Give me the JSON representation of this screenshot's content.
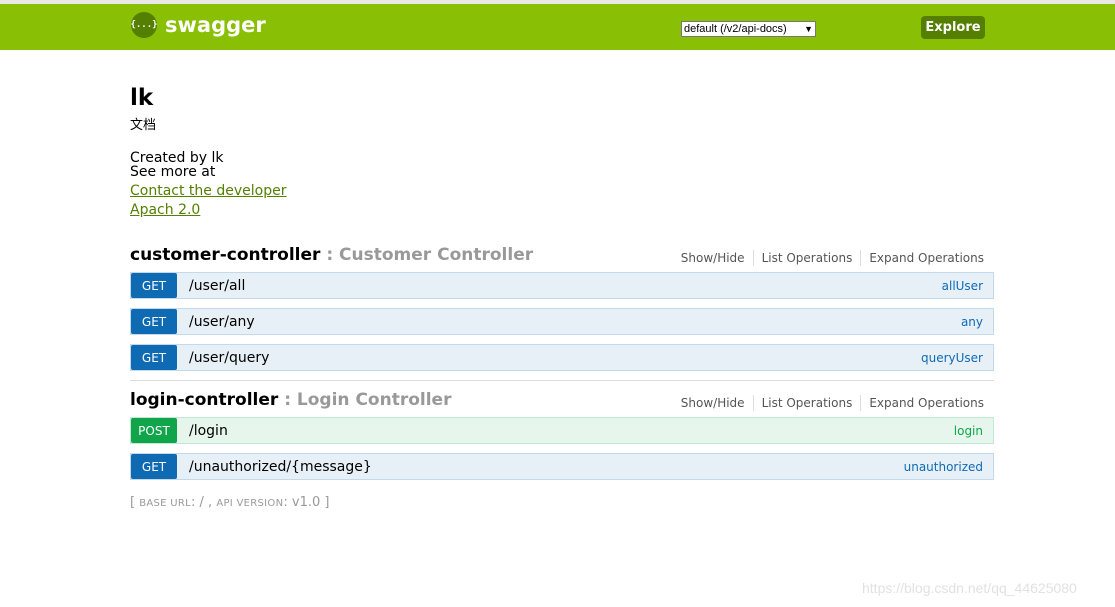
{
  "header": {
    "logo_icon_text": "{...}",
    "logo_text": "swagger",
    "api_select_value": "default (/v2/api-docs)",
    "explore_label": "Explore",
    "brand_color": "#89bf04"
  },
  "info": {
    "title": "lk",
    "description": "文档",
    "created_by": "Created by lk",
    "see_more": "See more at",
    "contact_link": "Contact the developer",
    "license_link": "Apach 2.0"
  },
  "resources": [
    {
      "name": "customer-controller",
      "separator": " : ",
      "description": "Customer Controller",
      "options": [
        "Show/Hide",
        "List Operations",
        "Expand Operations"
      ],
      "operations": [
        {
          "method": "GET",
          "path": "/user/all",
          "nickname": "allUser"
        },
        {
          "method": "GET",
          "path": "/user/any",
          "nickname": "any"
        },
        {
          "method": "GET",
          "path": "/user/query",
          "nickname": "queryUser"
        }
      ]
    },
    {
      "name": "login-controller",
      "separator": " : ",
      "description": "Login Controller",
      "options": [
        "Show/Hide",
        "List Operations",
        "Expand Operations"
      ],
      "operations": [
        {
          "method": "POST",
          "path": "/login",
          "nickname": "login"
        },
        {
          "method": "GET",
          "path": "/unauthorized/{message}",
          "nickname": "unauthorized"
        }
      ]
    }
  ],
  "footer": {
    "open": "[ ",
    "base_url_label": "BASE URL",
    "base_url_value": ": / , ",
    "api_version_label": "API VERSION",
    "api_version_value": ": v1.0",
    "close": " ]"
  },
  "watermark": "https://blog.csdn.net/qq_44625080"
}
